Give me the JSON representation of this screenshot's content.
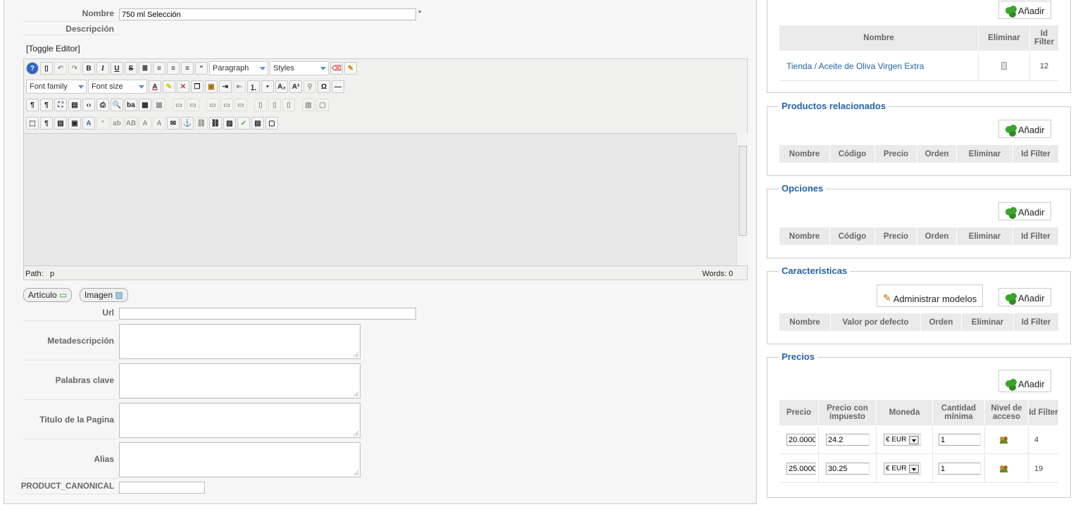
{
  "form": {
    "nombre_label": "Nombre",
    "nombre_value": "750 ml Selección",
    "required_mark": "*",
    "descripcion_label": "Descripción",
    "toggle_editor": "[Toggle Editor]",
    "url_label": "Url",
    "metadescripcion_label": "Metadescripción",
    "palabras_clave_label": "Palabras clave",
    "titulo_label": "Titulo de la Pagina",
    "alias_label": "Alias",
    "canonical_label": "PRODUCT_CANONICAL"
  },
  "editor": {
    "format_select": "Paragraph",
    "styles_select": "Styles",
    "font_family_select": "Font family",
    "font_size_select": "Font size",
    "path_label": "Path:",
    "path_value": "p",
    "words_label": "Words: 0",
    "articulo_button": "Artículo",
    "imagen_button": "Imagen"
  },
  "categories": {
    "add_label": "Añadir",
    "columns": [
      "Nombre",
      "Eliminar",
      "Id Filter"
    ],
    "rows": [
      {
        "nombre": "Tienda / Aceite de Oliva Virgen Extra",
        "id": "12"
      }
    ]
  },
  "related": {
    "legend": "Productos relacionados",
    "add_label": "Añadir",
    "columns": [
      "Nombre",
      "Código",
      "Precio",
      "Orden",
      "Eliminar",
      "Id Filter"
    ]
  },
  "options": {
    "legend": "Opciones",
    "add_label": "Añadir",
    "columns": [
      "Nombre",
      "Código",
      "Precio",
      "Orden",
      "Eliminar",
      "Id Filter"
    ]
  },
  "features": {
    "legend": "Características",
    "manage_label": "Administrar modelos",
    "add_label": "Añadir",
    "columns": [
      "Nombre",
      "Valor por defecto",
      "Orden",
      "Eliminar",
      "Id Filter"
    ]
  },
  "prices": {
    "legend": "Precios",
    "add_label": "Añadir",
    "columns": [
      "Precio",
      "Precio con impuesto",
      "Moneda",
      "Cantidad mínima",
      "Nivel de acceso",
      "Id Filter"
    ],
    "rows": [
      {
        "precio": "20.00000",
        "con_impuesto": "24.2",
        "moneda": "€ EUR",
        "cantidad": "1",
        "id": "4"
      },
      {
        "precio": "25.00000",
        "con_impuesto": "30.25",
        "moneda": "€ EUR",
        "cantidad": "1",
        "id": "19"
      }
    ]
  }
}
